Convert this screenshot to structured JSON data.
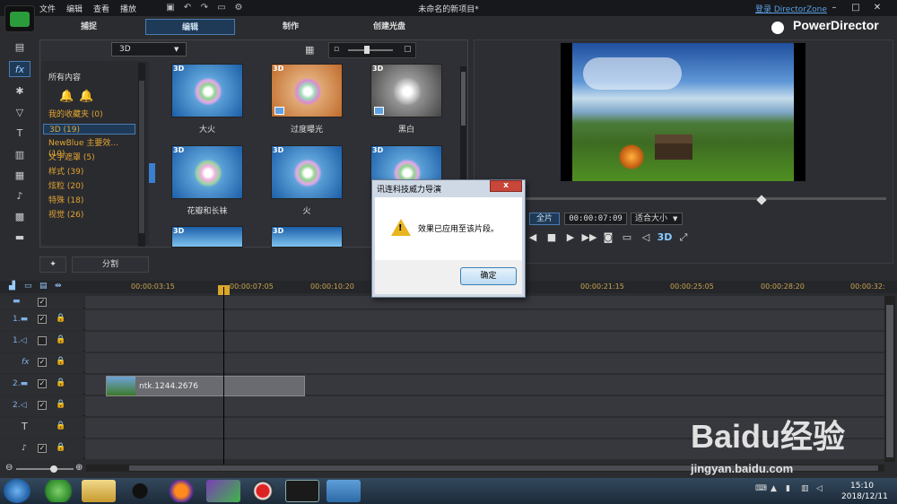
{
  "menu": {
    "items": [
      "文件",
      "编辑",
      "查看",
      "播放"
    ]
  },
  "title": "未命名的新项目*",
  "login": "登录 DirectorZone",
  "brand": "PowerDirector",
  "modes": [
    "捕捉",
    "编辑",
    "制作",
    "创建光盘"
  ],
  "library": {
    "combo": "3D",
    "all_content": "所有内容",
    "categories": [
      "我的收藏夹 (0)",
      "3D (19)",
      "NewBlue 主要效... (10)",
      "文字遮罩 (5)",
      "样式 (39)",
      "炫粒 (20)",
      "特殊 (18)",
      "视觉 (26)"
    ],
    "effects": [
      {
        "tag": "3D",
        "label": "大火"
      },
      {
        "tag": "3D",
        "label": "过度曝光"
      },
      {
        "tag": "3D",
        "label": "黑白"
      },
      {
        "tag": "3D",
        "label": "花瓣和长袜"
      },
      {
        "tag": "3D",
        "label": "火"
      },
      {
        "tag": "3D",
        "label": ""
      },
      {
        "tag": "3D",
        "label": ""
      },
      {
        "tag": "3D",
        "label": ""
      }
    ],
    "split": "分割"
  },
  "preview": {
    "mode": "全片",
    "timecode": "00:00:07:09",
    "fit": "适合大小",
    "stereo": "3D"
  },
  "timeline": {
    "ticks": [
      "00:00:03:15",
      "00:00:07:05",
      "00:00:10:20",
      "00:00:21:15",
      "00:00:25:05",
      "00:00:28:20",
      "00:00:32:"
    ],
    "tracks": [
      "",
      "1.",
      "1.",
      "",
      "2.",
      "2.",
      "",
      ""
    ],
    "clip": "ntk.1244.2676"
  },
  "dialog": {
    "title": "讯连科技威力导演",
    "message": "效果已应用至该片段。",
    "ok": "确定",
    "close": "x"
  },
  "clock": {
    "time": "15:10",
    "date": "2018/12/11"
  },
  "watermark": "Baidu经验",
  "watermark2": "jingyan.baidu.com"
}
